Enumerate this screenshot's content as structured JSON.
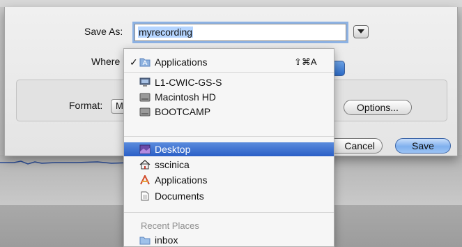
{
  "save_sheet": {
    "save_as_label": "Save As:",
    "filename": "myrecording",
    "where_label": "Where",
    "format_label": "Format:",
    "format_value": "M",
    "options_label": "Options...",
    "cancel_label": "Cancel",
    "save_label": "Save"
  },
  "where_menu": {
    "current": {
      "label": "Applications",
      "shortcut": "⇧⌘A",
      "icon": "applications-folder-icon"
    },
    "devices": [
      {
        "label": "L1-CWIC-GS-S",
        "icon": "computer-icon"
      },
      {
        "label": "Macintosh HD",
        "icon": "hard-drive-icon"
      },
      {
        "label": "BOOTCAMP",
        "icon": "hard-drive-icon"
      }
    ],
    "places": [
      {
        "label": "Desktop",
        "icon": "desktop-icon",
        "selected": true
      },
      {
        "label": "sscinica",
        "icon": "home-icon"
      },
      {
        "label": "Applications",
        "icon": "applications-icon"
      },
      {
        "label": "Documents",
        "icon": "documents-icon"
      }
    ],
    "recent_header": "Recent Places",
    "recent": [
      {
        "label": "inbox",
        "icon": "folder-icon"
      }
    ]
  },
  "colors": {
    "selection": "#3a6fd0",
    "focus_ring": "#8db2e3",
    "default_button": "#7fb0ee"
  }
}
